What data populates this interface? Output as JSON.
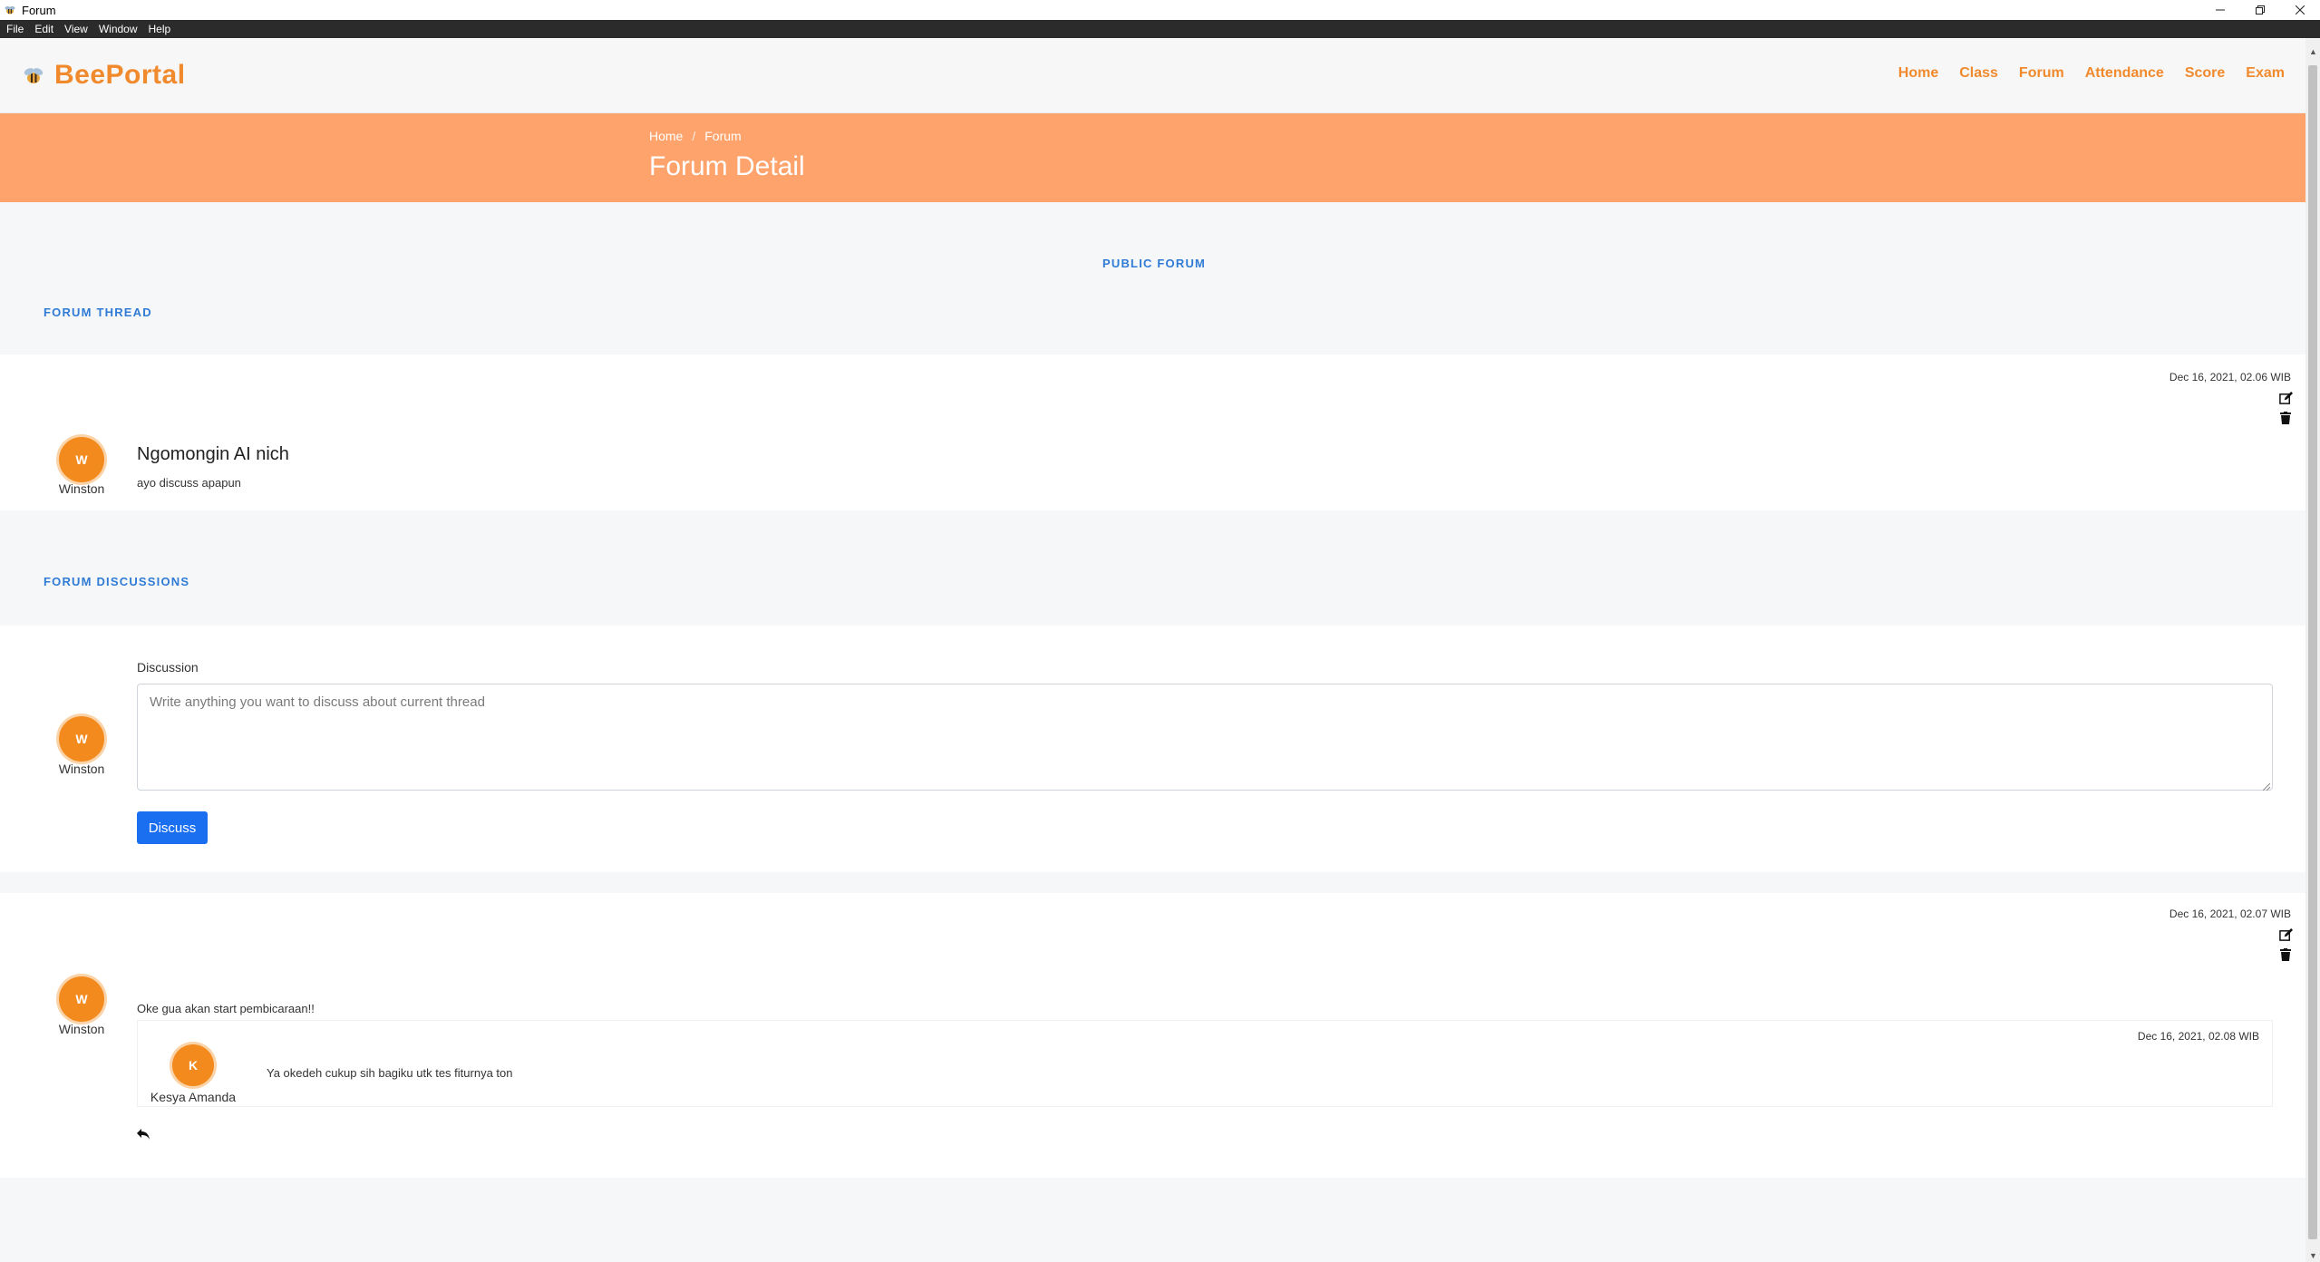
{
  "window": {
    "title": "Forum",
    "menu": [
      "File",
      "Edit",
      "View",
      "Window",
      "Help"
    ]
  },
  "brand": {
    "name": "BeePortal",
    "logo_icon": "bee-icon"
  },
  "nav": [
    "Home",
    "Class",
    "Forum",
    "Attendance",
    "Score",
    "Exam"
  ],
  "breadcrumb": {
    "items": [
      "Home",
      "Forum"
    ],
    "separator": "/"
  },
  "page_title": "Forum Detail",
  "labels": {
    "public_forum": "PUBLIC FORUM",
    "forum_thread": "FORUM THREAD",
    "forum_discussions": "FORUM DISCUSSIONS"
  },
  "thread": {
    "timestamp": "Dec 16, 2021, 02.06 WIB",
    "author_initial": "W",
    "author_name": "Winston",
    "title": "Ngomongin AI nich",
    "body": "ayo discuss apapun"
  },
  "composer": {
    "author_initial": "W",
    "author_name": "Winston",
    "label": "Discussion",
    "placeholder": "Write anything you want to discuss about current thread",
    "button": "Discuss"
  },
  "discussion": {
    "timestamp": "Dec 16, 2021, 02.07 WIB",
    "author_initial": "W",
    "author_name": "Winston",
    "body": "Oke gua akan start pembicaraan!!",
    "reply": {
      "timestamp": "Dec 16, 2021, 02.08 WIB",
      "author_initial": "K",
      "author_name": "Kesya Amanda",
      "body": "Ya okedeh cukup sih bagiku utk tes fiturnya ton"
    }
  },
  "colors": {
    "brand_orange": "#f08a2c",
    "banner": "#ffa36c",
    "link_blue": "#2f7bd6",
    "button_blue": "#1a6ff0"
  }
}
